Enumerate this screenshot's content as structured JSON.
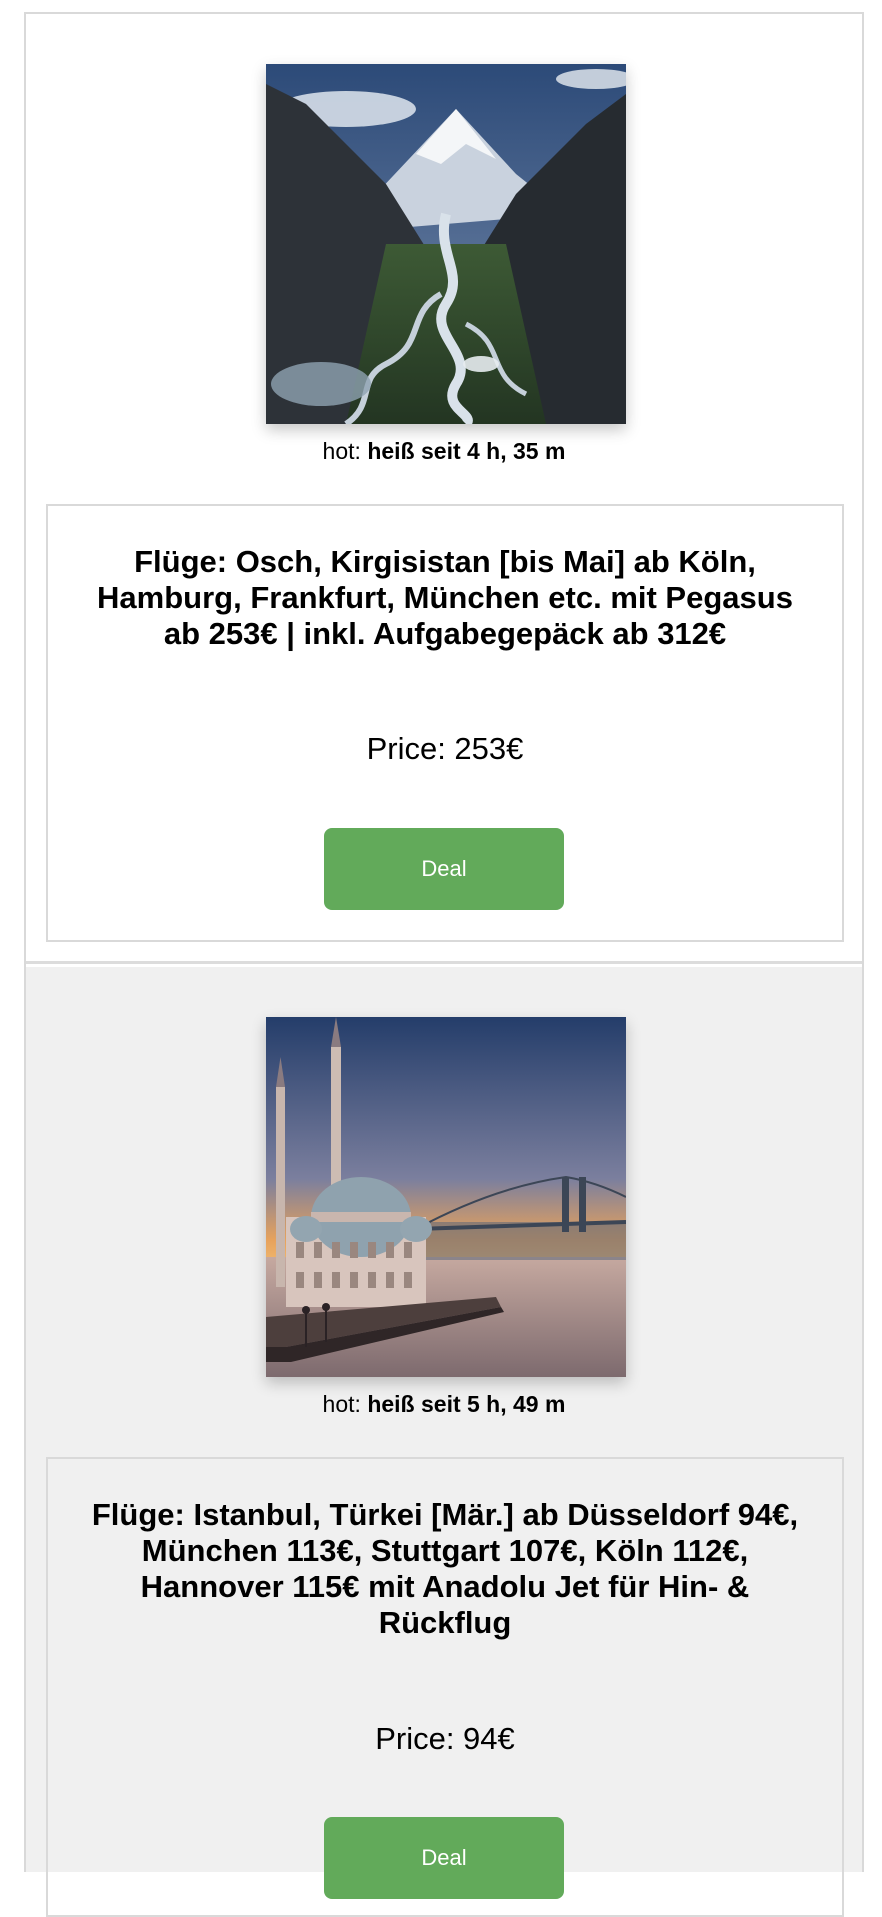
{
  "deals": [
    {
      "hot_label": "hot:",
      "hot_value": "heiß seit 4 h, 35 m",
      "title": "Flüge: Osch, Kirgisistan [bis Mai] ab Köln, Hamburg, Frankfurt, München etc. mit Pegasus ab 253€ | inkl. Aufgabegepäck ab 312€",
      "price": "Price: 253€",
      "button_label": "Deal"
    },
    {
      "hot_label": "hot:",
      "hot_value": "heiß seit 5 h, 49 m",
      "title": "Flüge: Istanbul, Türkei [Mär.] ab Düsseldorf 94€, München 113€, Stuttgart 107€, Köln 112€, Hannover 115€ mit Anadolu Jet für Hin- & Rückflug",
      "price": "Price: 94€",
      "button_label": "Deal"
    }
  ],
  "colors": {
    "deal_button": "#62aa5a",
    "border": "#d9d9d9",
    "second_section_bg": "#f0f0f0"
  }
}
